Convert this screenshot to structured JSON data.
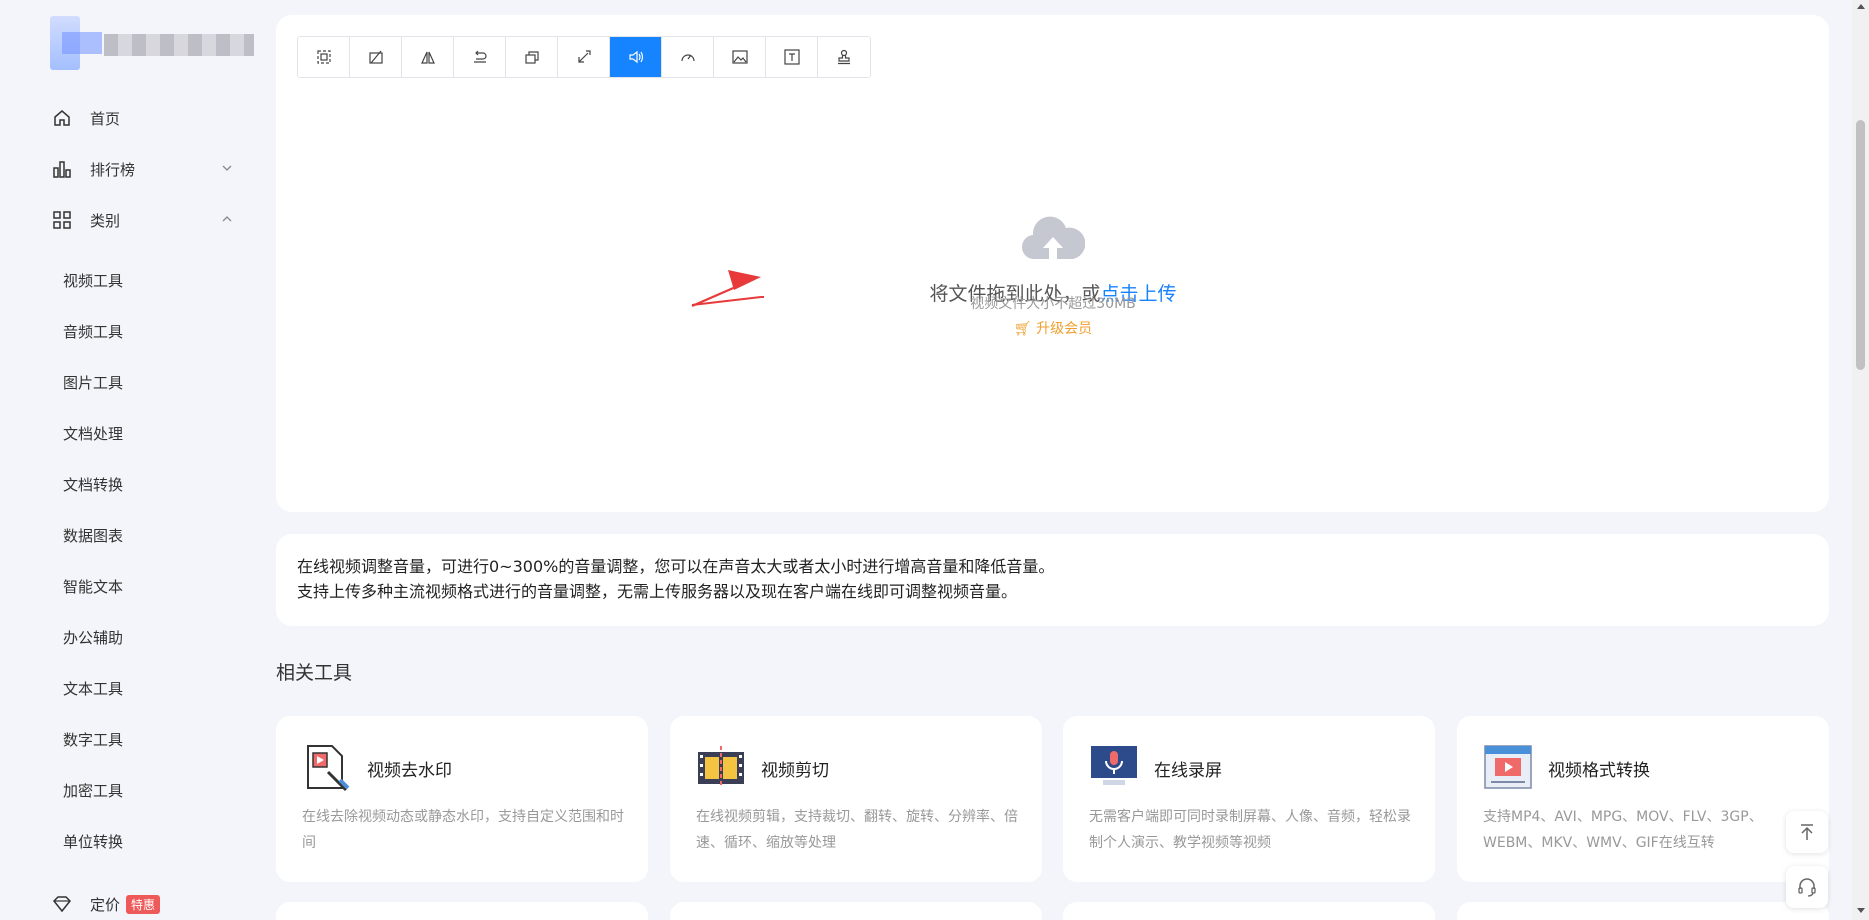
{
  "sidebar": {
    "nav": [
      {
        "label": "首页",
        "icon": "home-icon"
      },
      {
        "label": "排行榜",
        "icon": "bar-chart-icon"
      },
      {
        "label": "类别",
        "icon": "grid-icon"
      }
    ],
    "categories": [
      "视频工具",
      "音频工具",
      "图片工具",
      "文档处理",
      "文档转换",
      "数据图表",
      "智能文本",
      "办公辅助",
      "文本工具",
      "数字工具",
      "加密工具",
      "单位转换"
    ],
    "pricing": {
      "label": "定价",
      "badge": "特惠",
      "icon": "diamond-icon"
    }
  },
  "toolbar": {
    "tools": [
      "crop-icon",
      "rotate-icon",
      "flip-icon",
      "reverse-icon",
      "resize-icon",
      "compress-icon",
      "volume-icon",
      "speed-icon",
      "image-icon",
      "text-icon",
      "stamp-icon"
    ],
    "active_index": 6,
    "active_color": "#1683ff"
  },
  "upload": {
    "prompt": "将文件拖到此处，或",
    "link": "点击上传",
    "limit": "视频文件大小不超过30MB",
    "upgrade": "升级会员"
  },
  "description": {
    "line1": "在线视频调整音量，可进行0~300%的音量调整，您可以在声音太大或者太小时进行增高音量和降低音量。",
    "line2": "支持上传多种主流视频格式进行的音量调整，无需上传服务器以及现在客户端在线即可调整视频音量。"
  },
  "related": {
    "title": "相关工具",
    "items": [
      {
        "title": "视频去水印",
        "desc": "在线去除视频动态或静态水印，支持自定义范围和时间",
        "icon": "watermark-remove-icon"
      },
      {
        "title": "视频剪切",
        "desc": "在线视频剪辑，支持裁切、翻转、旋转、分辨率、倍速、循环、缩放等处理",
        "icon": "film-cut-icon"
      },
      {
        "title": "在线录屏",
        "desc": "无需客户端即可同时录制屏幕、人像、音频，轻松录制个人演示、教学视频等视频",
        "icon": "screen-record-icon"
      },
      {
        "title": "视频格式转换",
        "desc": "支持MP4、AVI、MPG、MOV、FLV、3GP、WEBM、MKV、WMV、GIF在线互转",
        "icon": "video-convert-icon"
      }
    ]
  },
  "float": {
    "top_icon": "back-to-top-icon",
    "service_icon": "headset-icon"
  },
  "colors": {
    "accent": "#1683ff",
    "annotation": "#e83a3a",
    "upgrade": "#f0a030"
  }
}
